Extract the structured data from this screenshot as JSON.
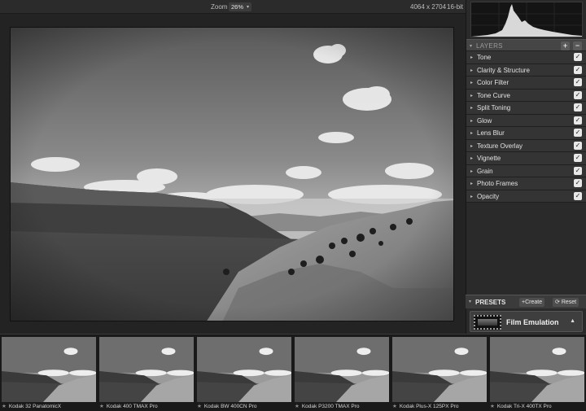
{
  "toolbar": {
    "zoom_label": "Zoom",
    "zoom_value": "26%",
    "image_dimensions": "4064 x 2704",
    "bit_depth": "16-bit"
  },
  "layers": {
    "title": "LAYERS",
    "add_label": "+",
    "remove_label": "−",
    "items": [
      {
        "label": "Tone",
        "checked": true
      },
      {
        "label": "Clarity & Structure",
        "checked": true
      },
      {
        "label": "Color Filter",
        "checked": true
      },
      {
        "label": "Tone Curve",
        "checked": true
      },
      {
        "label": "Split Toning",
        "checked": true
      },
      {
        "label": "Glow",
        "checked": true
      },
      {
        "label": "Lens Blur",
        "checked": true
      },
      {
        "label": "Texture Overlay",
        "checked": true
      },
      {
        "label": "Vignette",
        "checked": true
      },
      {
        "label": "Grain",
        "checked": true
      },
      {
        "label": "Photo Frames",
        "checked": true
      },
      {
        "label": "Opacity",
        "checked": true
      }
    ]
  },
  "presets": {
    "title": "PRESETS",
    "create_label": "Create",
    "reset_label": "Reset",
    "group_name": "Film Emulation"
  },
  "filmstrip": {
    "items": [
      {
        "label": "Kodak 32 PanatomicX"
      },
      {
        "label": "Kodak 400 TMAX Pro"
      },
      {
        "label": "Kodak BW 400CN Pro"
      },
      {
        "label": "Kodak P3200 TMAX Pro"
      },
      {
        "label": "Kodak Plus-X 125PX Pro"
      },
      {
        "label": "Kodak Tri-X 400TX Pro"
      }
    ]
  },
  "icons": {
    "check": "✓",
    "star": "★",
    "disclosure": "▸",
    "disclosure_open": "▾",
    "collapse": "▲",
    "dropdown": "▾",
    "refresh": "⟳"
  }
}
